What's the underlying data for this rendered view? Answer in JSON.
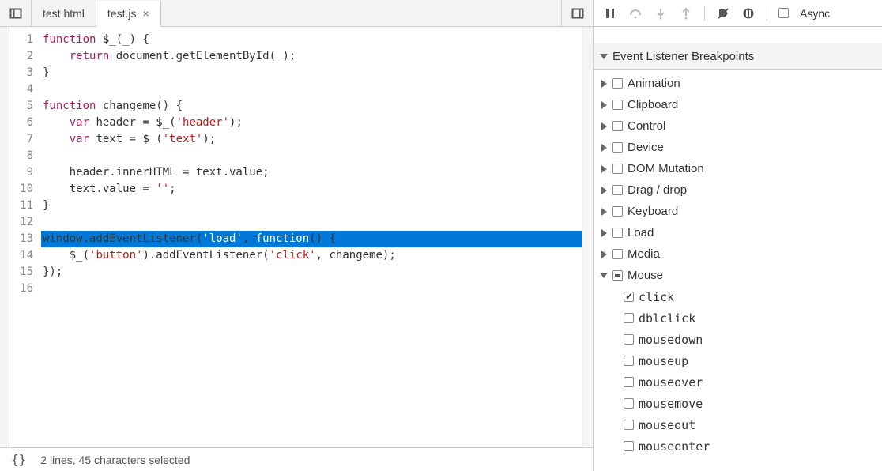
{
  "tabs": [
    {
      "label": "test.html",
      "active": false
    },
    {
      "label": "test.js",
      "active": true
    }
  ],
  "code": {
    "lines": [
      {
        "n": 1,
        "tokens": [
          [
            "kw",
            "function"
          ],
          [
            "pn",
            " $_(_) {"
          ]
        ]
      },
      {
        "n": 2,
        "tokens": [
          [
            "pn",
            "    "
          ],
          [
            "kw",
            "return"
          ],
          [
            "pn",
            " document.getElementById(_);"
          ]
        ]
      },
      {
        "n": 3,
        "tokens": [
          [
            "pn",
            "}"
          ]
        ]
      },
      {
        "n": 4,
        "tokens": [
          [
            "pn",
            ""
          ]
        ]
      },
      {
        "n": 5,
        "tokens": [
          [
            "kw",
            "function"
          ],
          [
            "pn",
            " changeme() {"
          ]
        ]
      },
      {
        "n": 6,
        "tokens": [
          [
            "pn",
            "    "
          ],
          [
            "kw",
            "var"
          ],
          [
            "pn",
            " header = $_("
          ],
          [
            "str",
            "'header'"
          ],
          [
            "pn",
            ");"
          ]
        ]
      },
      {
        "n": 7,
        "tokens": [
          [
            "pn",
            "    "
          ],
          [
            "kw",
            "var"
          ],
          [
            "pn",
            " text = $_("
          ],
          [
            "str",
            "'text'"
          ],
          [
            "pn",
            ");"
          ]
        ]
      },
      {
        "n": 8,
        "tokens": [
          [
            "pn",
            ""
          ]
        ]
      },
      {
        "n": 9,
        "tokens": [
          [
            "pn",
            "    header.innerHTML = text.value;"
          ]
        ]
      },
      {
        "n": 10,
        "tokens": [
          [
            "pn",
            "    text.value = "
          ],
          [
            "str",
            "''"
          ],
          [
            "pn",
            ";"
          ]
        ]
      },
      {
        "n": 11,
        "tokens": [
          [
            "pn",
            "}"
          ]
        ]
      },
      {
        "n": 12,
        "tokens": [
          [
            "pn",
            ""
          ]
        ]
      },
      {
        "n": 13,
        "hl": true,
        "tokens": [
          [
            "pn",
            "window.addEventListener("
          ],
          [
            "str",
            "'load'"
          ],
          [
            "pn",
            ", "
          ],
          [
            "kw",
            "function"
          ],
          [
            "pn",
            "() {"
          ]
        ]
      },
      {
        "n": 14,
        "tokens": [
          [
            "pn",
            "    $_("
          ],
          [
            "str",
            "'button'"
          ],
          [
            "pn",
            ").addEventListener("
          ],
          [
            "str",
            "'click'"
          ],
          [
            "pn",
            ", changeme);"
          ]
        ]
      },
      {
        "n": 15,
        "tokens": [
          [
            "pn",
            "});"
          ]
        ]
      },
      {
        "n": 16,
        "tokens": [
          [
            "pn",
            ""
          ]
        ]
      }
    ]
  },
  "status": {
    "text": "2 lines, 45 characters selected"
  },
  "toolbar": {
    "async_label": "Async"
  },
  "breakpoints": {
    "header": "Event Listener Breakpoints",
    "categories": [
      {
        "label": "Animation",
        "expanded": false,
        "state": "empty"
      },
      {
        "label": "Clipboard",
        "expanded": false,
        "state": "empty"
      },
      {
        "label": "Control",
        "expanded": false,
        "state": "empty"
      },
      {
        "label": "Device",
        "expanded": false,
        "state": "empty"
      },
      {
        "label": "DOM Mutation",
        "expanded": false,
        "state": "empty"
      },
      {
        "label": "Drag / drop",
        "expanded": false,
        "state": "empty"
      },
      {
        "label": "Keyboard",
        "expanded": false,
        "state": "empty"
      },
      {
        "label": "Load",
        "expanded": false,
        "state": "empty"
      },
      {
        "label": "Media",
        "expanded": false,
        "state": "empty"
      },
      {
        "label": "Mouse",
        "expanded": true,
        "state": "indeterminate",
        "children": [
          {
            "label": "click",
            "state": "checked"
          },
          {
            "label": "dblclick",
            "state": "empty"
          },
          {
            "label": "mousedown",
            "state": "empty"
          },
          {
            "label": "mouseup",
            "state": "empty"
          },
          {
            "label": "mouseover",
            "state": "empty"
          },
          {
            "label": "mousemove",
            "state": "empty"
          },
          {
            "label": "mouseout",
            "state": "empty"
          },
          {
            "label": "mouseenter",
            "state": "empty"
          }
        ]
      }
    ]
  }
}
